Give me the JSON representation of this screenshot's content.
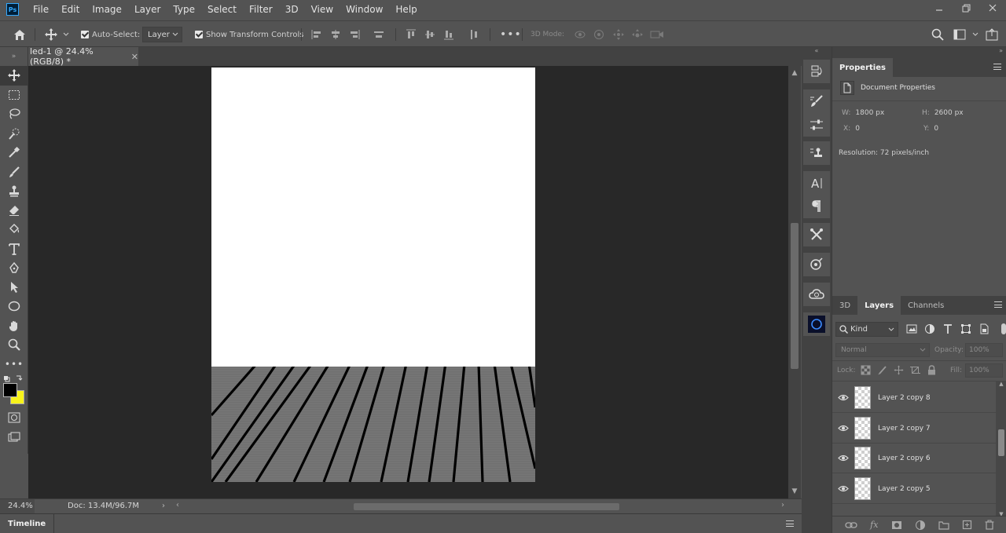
{
  "app": {
    "logo_text": "Ps",
    "menu": [
      "File",
      "Edit",
      "Image",
      "Layer",
      "Type",
      "Select",
      "Filter",
      "3D",
      "View",
      "Window",
      "Help"
    ]
  },
  "options_bar": {
    "auto_select_label": "Auto-Select:",
    "auto_select_checked": true,
    "auto_select_target": "Layer",
    "show_transform_label": "Show Transform Controls",
    "show_transform_checked": true,
    "mode_3d_label": "3D Mode:"
  },
  "document": {
    "tab_title": "led-1 @ 24.4% (RGB/8) *",
    "canvas_bg": "#ffffff",
    "floor_color": "#737373",
    "line_color": "#000000"
  },
  "status": {
    "zoom": "24.4%",
    "doc_info": "Doc: 13.4M/96.7M"
  },
  "timeline": {
    "label": "Timeline"
  },
  "properties": {
    "tab": "Properties",
    "section": "Document Properties",
    "w_label": "W:",
    "w_value": "1800 px",
    "h_label": "H:",
    "h_value": "2600 px",
    "x_label": "X:",
    "x_value": "0",
    "y_label": "Y:",
    "y_value": "0",
    "resolution": "Resolution: 72 pixels/inch"
  },
  "layers_panel": {
    "tabs": [
      "3D",
      "Layers",
      "Channels"
    ],
    "active_tab": "Layers",
    "filter_kind": "Kind",
    "blend_mode": "Normal",
    "opacity_label": "Opacity:",
    "opacity_value": "100%",
    "lock_label": "Lock:",
    "fill_label": "Fill:",
    "fill_value": "100%",
    "layers": [
      {
        "name": "Layer 2 copy 8",
        "visible": true
      },
      {
        "name": "Layer 2 copy 7",
        "visible": true
      },
      {
        "name": "Layer 2 copy 6",
        "visible": true
      },
      {
        "name": "Layer 2 copy 5",
        "visible": true
      }
    ]
  },
  "colors": {
    "foreground": "#000000",
    "background": "#f7f21a"
  }
}
